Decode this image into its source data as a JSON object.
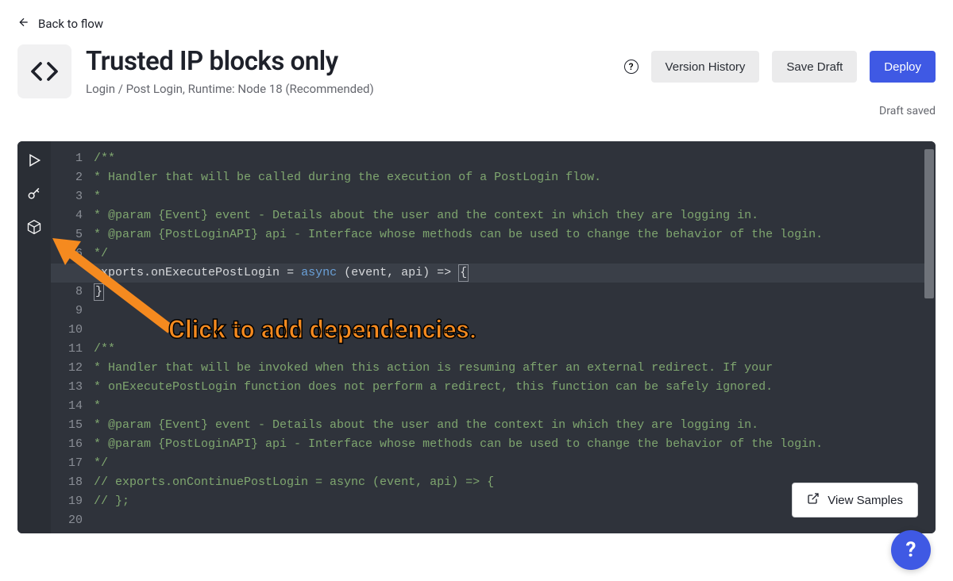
{
  "back": {
    "label": "Back to flow"
  },
  "page": {
    "title": "Trusted IP blocks only",
    "subtitle": "Login / Post Login, Runtime: Node 18 (Recommended)"
  },
  "actions": {
    "history": "Version History",
    "save": "Save Draft",
    "deploy": "Deploy"
  },
  "status": {
    "text": "Draft saved"
  },
  "annotation": {
    "text": "Click to add dependencies."
  },
  "view_samples": {
    "label": "View Samples"
  },
  "fab": {
    "glyph": "?"
  },
  "code": {
    "lines": [
      {
        "n": 1,
        "cls": "c-comment",
        "t": "/**"
      },
      {
        "n": 2,
        "cls": "c-comment",
        "t": "* Handler that will be called during the execution of a PostLogin flow."
      },
      {
        "n": 3,
        "cls": "c-comment",
        "t": "*"
      },
      {
        "n": 4,
        "cls": "c-comment",
        "t": "* @param {Event} event - Details about the user and the context in which they are logging in."
      },
      {
        "n": 5,
        "cls": "c-comment",
        "t": "* @param {PostLoginAPI} api - Interface whose methods can be used to change the behavior of the login."
      },
      {
        "n": 6,
        "cls": "c-comment",
        "t": "*/"
      },
      {
        "n": 7,
        "cls": "code7",
        "t": ""
      },
      {
        "n": 8,
        "cls": "code8",
        "t": ""
      },
      {
        "n": 9,
        "cls": "",
        "t": ""
      },
      {
        "n": 10,
        "cls": "",
        "t": ""
      },
      {
        "n": 11,
        "cls": "c-comment",
        "t": "/**"
      },
      {
        "n": 12,
        "cls": "c-comment",
        "t": "* Handler that will be invoked when this action is resuming after an external redirect. If your"
      },
      {
        "n": 13,
        "cls": "c-comment",
        "t": "* onExecutePostLogin function does not perform a redirect, this function can be safely ignored."
      },
      {
        "n": 14,
        "cls": "c-comment",
        "t": "*"
      },
      {
        "n": 15,
        "cls": "c-comment",
        "t": "* @param {Event} event - Details about the user and the context in which they are logging in."
      },
      {
        "n": 16,
        "cls": "c-comment",
        "t": "* @param {PostLoginAPI} api - Interface whose methods can be used to change the behavior of the login."
      },
      {
        "n": 17,
        "cls": "c-comment",
        "t": "*/"
      },
      {
        "n": 18,
        "cls": "c-comment",
        "t": "// exports.onContinuePostLogin = async (event, api) => {"
      },
      {
        "n": 19,
        "cls": "c-comment",
        "t": "// };"
      },
      {
        "n": 20,
        "cls": "",
        "t": ""
      }
    ],
    "line7": {
      "p1": "exports",
      "p2": ".",
      "p3": "onExecutePostLogin",
      "p4": " = ",
      "p5": "async",
      "p6": " (",
      "p7": "event",
      "p8": ", ",
      "p9": "api",
      "p10": ") => ",
      "p11": "{"
    },
    "line8": {
      "p1": "}"
    }
  }
}
